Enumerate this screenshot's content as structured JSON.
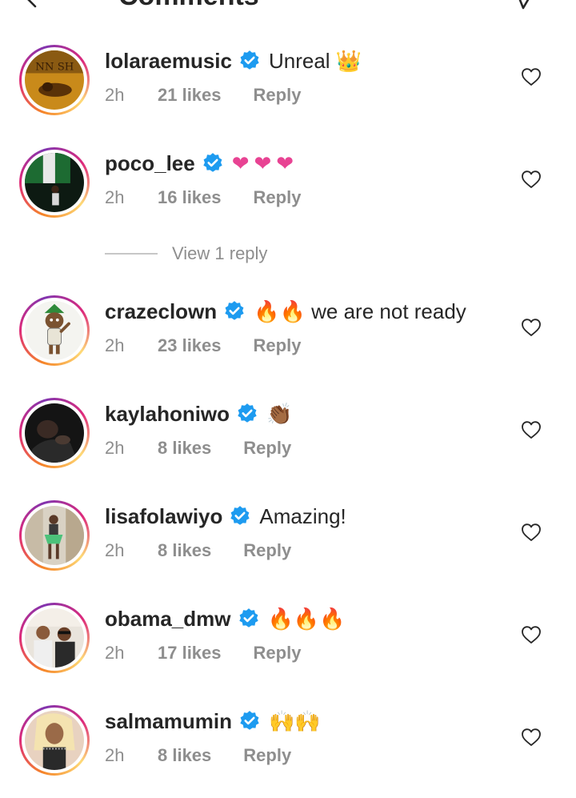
{
  "header": {
    "title": "Comments"
  },
  "view_replies_label": "View 1 reply",
  "comments": [
    {
      "username": "lolaraemusic",
      "text": "Unreal 👑",
      "time": "2h",
      "likes": "21 likes",
      "reply": "Reply"
    },
    {
      "username": "poco_lee",
      "text": "❤❤❤",
      "time": "2h",
      "likes": "16 likes",
      "reply": "Reply"
    },
    {
      "username": "crazeclown",
      "text": "🔥🔥 we are not ready",
      "time": "2h",
      "likes": "23 likes",
      "reply": "Reply"
    },
    {
      "username": "kaylahoniwo",
      "text": "👏🏾",
      "time": "2h",
      "likes": "8 likes",
      "reply": "Reply"
    },
    {
      "username": "lisafolawiyo",
      "text": "Amazing!",
      "time": "2h",
      "likes": "8 likes",
      "reply": "Reply"
    },
    {
      "username": "obama_dmw",
      "text": "🔥🔥🔥",
      "time": "2h",
      "likes": "17 likes",
      "reply": "Reply"
    },
    {
      "username": "salmamumin",
      "text": "🙌🙌",
      "time": "2h",
      "likes": "8 likes",
      "reply": "Reply"
    }
  ],
  "colors": {
    "verified": "#1d9bf0",
    "muted": "#8e8e8e",
    "heart_emoji": "#e84393"
  },
  "icons": {
    "back": "back-arrow-icon",
    "header_action": "chevron-icon",
    "verified": "verified-badge-icon",
    "like": "heart-outline-icon"
  }
}
